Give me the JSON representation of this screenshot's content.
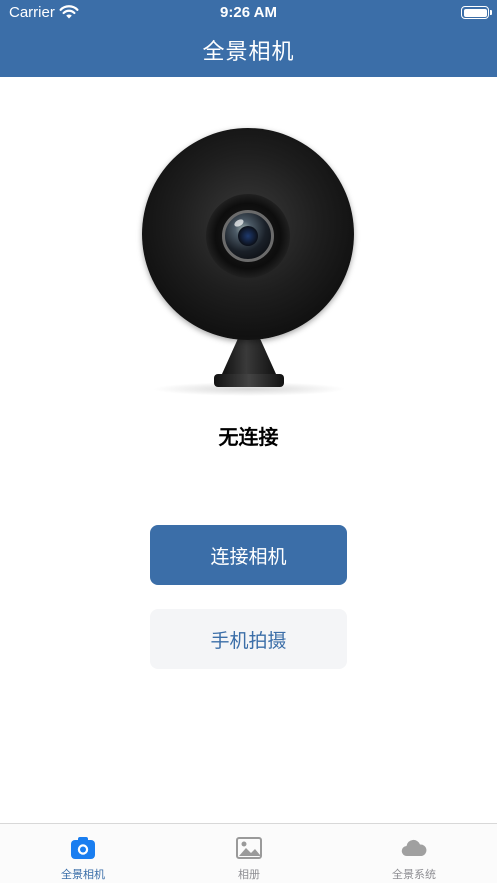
{
  "status_bar": {
    "carrier": "Carrier",
    "time": "9:26 AM"
  },
  "nav": {
    "title": "全景相机"
  },
  "main": {
    "connection_status": "无连接",
    "connect_button_label": "连接相机",
    "phone_shoot_button_label": "手机拍摄"
  },
  "tabs": [
    {
      "label": "全景相机",
      "icon": "camera-icon",
      "active": true
    },
    {
      "label": "相册",
      "icon": "photo-icon",
      "active": false
    },
    {
      "label": "全景系统",
      "icon": "cloud-icon",
      "active": false
    }
  ],
  "colors": {
    "accent": "#3b6ea8",
    "tab_active_icon": "#1a7ef0",
    "tab_inactive": "#8e8e93"
  }
}
